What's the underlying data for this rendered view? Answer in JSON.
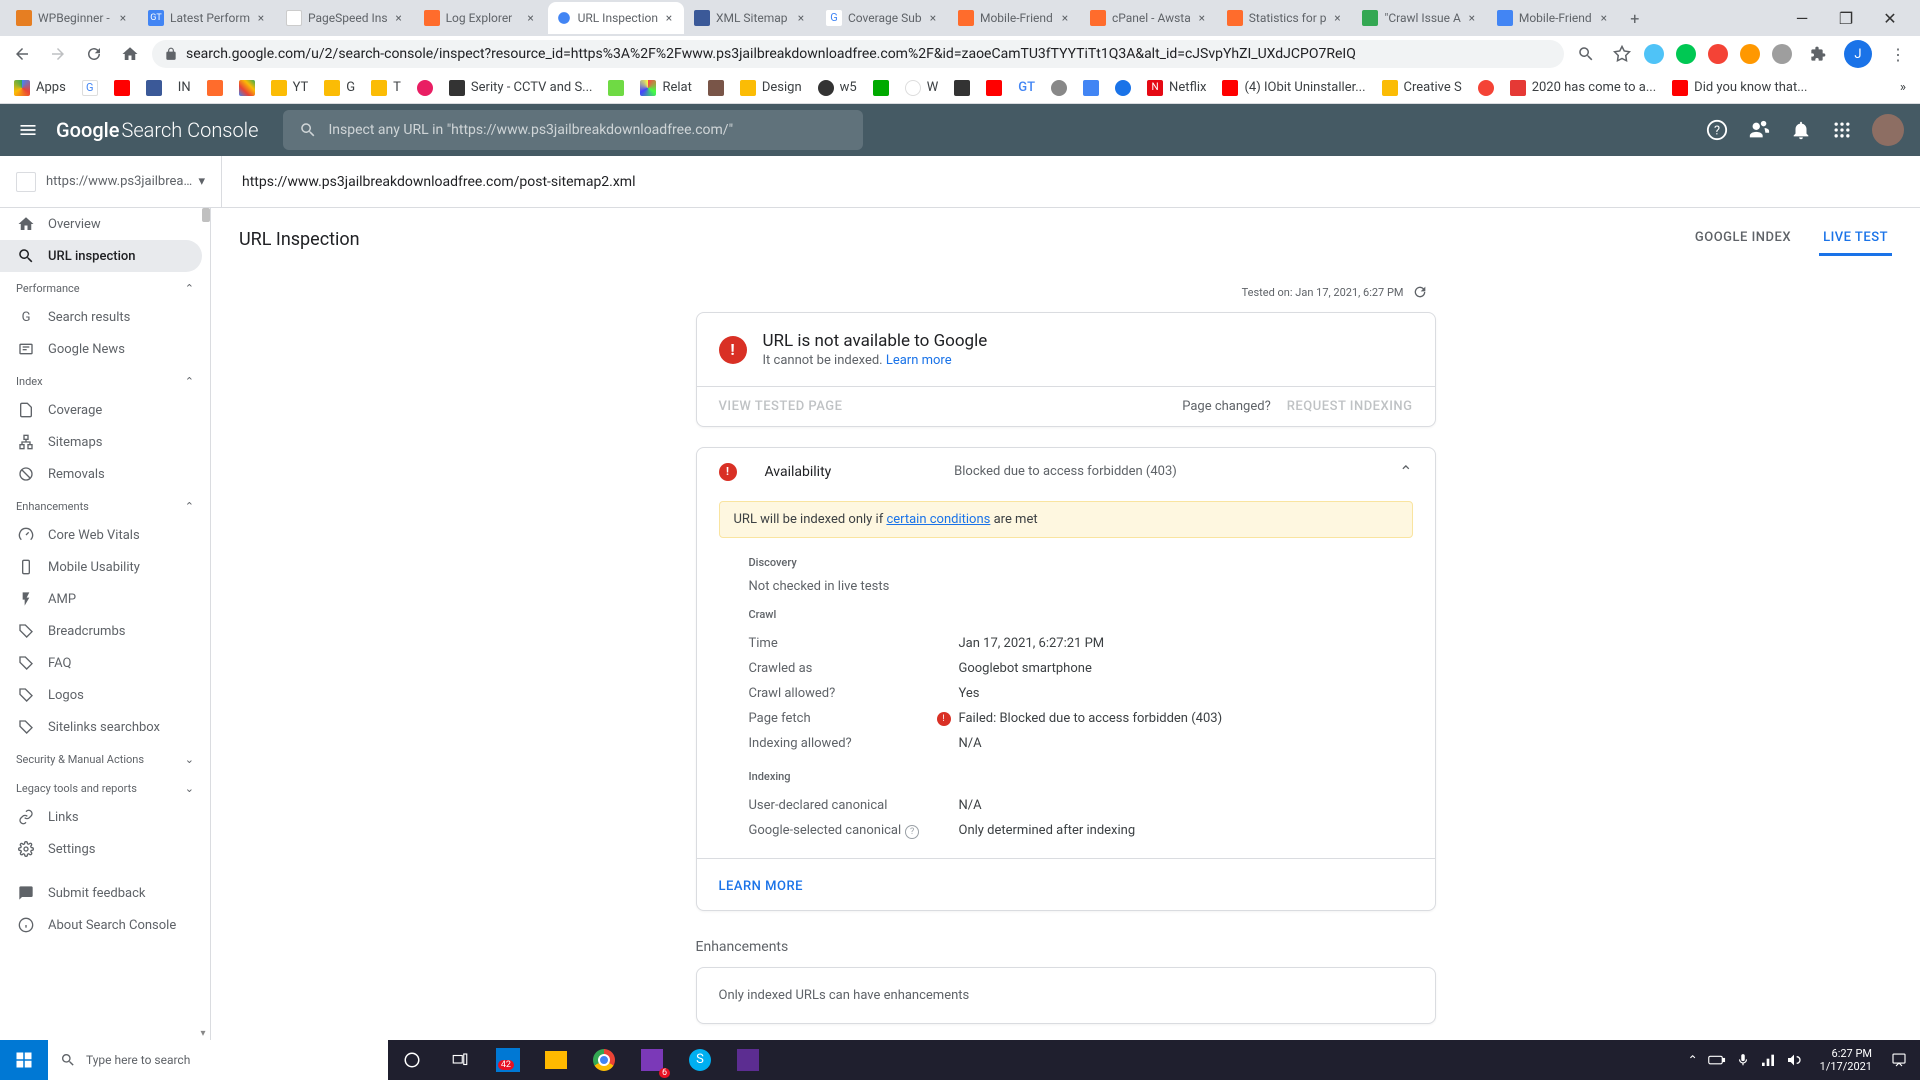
{
  "browser": {
    "tabs": [
      {
        "title": "WPBeginner -",
        "favicon_color": "#e67e22"
      },
      {
        "title": "Latest Perform",
        "favicon_color": "#4285f4"
      },
      {
        "title": "PageSpeed Ins",
        "favicon_color": "#5f6368"
      },
      {
        "title": "Log Explorer",
        "favicon_color": "#ff6c2c"
      },
      {
        "title": "URL Inspection",
        "favicon_color": "#4285f4",
        "active": true
      },
      {
        "title": "XML Sitemap",
        "favicon_color": "#3b5998"
      },
      {
        "title": "Coverage Sub",
        "favicon_color": "#4285f4"
      },
      {
        "title": "Mobile-Friend",
        "favicon_color": "#ff6c2c"
      },
      {
        "title": "cPanel - Awsta",
        "favicon_color": "#ff6c2c"
      },
      {
        "title": "Statistics for p",
        "favicon_color": "#ff6c2c"
      },
      {
        "title": "\"Crawl Issue A",
        "favicon_color": "#34a853"
      },
      {
        "title": "Mobile-Friend",
        "favicon_color": "#4285f4"
      }
    ],
    "url": "search.google.com/u/2/search-console/inspect?resource_id=https%3A%2F%2Fwww.ps3jailbreakdownloadfree.com%2F&id=zaoeCamTU3fTYYTiTt1Q3A&alt_id=cJSvpYhZI_UXdJCPO7ReIQ",
    "bookmarks": [
      "Apps",
      "G",
      "",
      "",
      "IN",
      "",
      "",
      "",
      "YT",
      "",
      "G",
      "",
      "T",
      "",
      "Serity - CCTV and S...",
      "",
      "",
      "Relat",
      "",
      "",
      "Design",
      "",
      "w5",
      "",
      "",
      "W",
      "",
      "",
      "",
      "GT",
      "",
      "",
      "",
      "",
      "N",
      "Netflix",
      "",
      "(4) IObit Uninstaller...",
      "",
      "Creative S",
      "",
      "",
      "2020 has come to a...",
      "",
      "Did you know that..."
    ]
  },
  "gsc": {
    "product": "Search Console",
    "brand": "Google",
    "search_placeholder": "Inspect any URL in \"https://www.ps3jailbreakdownloadfree.com/\"",
    "property_text": "https://www.ps3jailbreakdow...",
    "inspected_url": "https://www.ps3jailbreakdownloadfree.com/post-sitemap2.xml"
  },
  "sidebar": {
    "overview": "Overview",
    "url_inspection": "URL inspection",
    "sections": {
      "performance": "Performance",
      "index": "Index",
      "enhancements": "Enhancements",
      "security": "Security & Manual Actions",
      "legacy": "Legacy tools and reports"
    },
    "perf_items": {
      "search_results": "Search results",
      "google_news": "Google News"
    },
    "index_items": {
      "coverage": "Coverage",
      "sitemaps": "Sitemaps",
      "removals": "Removals"
    },
    "enh_items": {
      "cwv": "Core Web Vitals",
      "mobile": "Mobile Usability",
      "amp": "AMP",
      "breadcrumbs": "Breadcrumbs",
      "faq": "FAQ",
      "logos": "Logos",
      "sitelinks": "Sitelinks searchbox"
    },
    "links": "Links",
    "settings": "Settings",
    "feedback": "Submit feedback",
    "about": "About Search Console"
  },
  "page": {
    "title": "URL Inspection",
    "tabs": {
      "google_index": "GOOGLE INDEX",
      "live_test": "LIVE TEST"
    },
    "tested_prefix": "Tested on: ",
    "tested_stamp": "Jan 17, 2021, 6:27 PM"
  },
  "status_card": {
    "title": "URL is not available to Google",
    "subtitle": "It cannot be indexed. ",
    "learn_more": "Learn more",
    "view_tested": "VIEW TESTED PAGE",
    "page_changed": "Page changed?",
    "request_indexing": "REQUEST INDEXING"
  },
  "availability": {
    "title": "Availability",
    "status": "Blocked due to access forbidden (403)",
    "note_prefix": "URL will be indexed only if ",
    "note_link": "certain conditions",
    "note_suffix": " are met",
    "discovery_title": "Discovery",
    "discovery_text": "Not checked in live tests",
    "crawl_title": "Crawl",
    "crawl": {
      "time_label": "Time",
      "time_val": "Jan 17, 2021, 6:27:21 PM",
      "crawled_as_label": "Crawled as",
      "crawled_as_val": "Googlebot smartphone",
      "crawl_allowed_label": "Crawl allowed?",
      "crawl_allowed_val": "Yes",
      "page_fetch_label": "Page fetch",
      "page_fetch_val": "Failed: Blocked due to access forbidden (403)",
      "indexing_allowed_label": "Indexing allowed?",
      "indexing_allowed_val": "N/A"
    },
    "indexing_title": "Indexing",
    "indexing": {
      "user_canon_label": "User-declared canonical",
      "user_canon_val": "N/A",
      "google_canon_label": "Google-selected canonical",
      "google_canon_val": "Only determined after indexing"
    },
    "learn_more": "LEARN MORE"
  },
  "enhancements": {
    "title": "Enhancements",
    "text": "Only indexed URLs can have enhancements"
  },
  "taskbar": {
    "search_placeholder": "Type here to search",
    "time": "6:27 PM",
    "date": "1/17/2021"
  }
}
